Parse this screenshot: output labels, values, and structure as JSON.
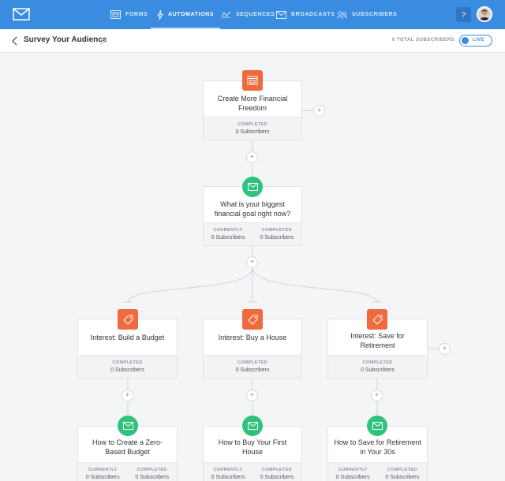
{
  "nav": {
    "items": [
      {
        "label": "FORMS",
        "icon": "forms-icon"
      },
      {
        "label": "AUTOMATIONS",
        "icon": "lightning-icon"
      },
      {
        "label": "SEQUENCES",
        "icon": "sequences-icon"
      },
      {
        "label": "BROADCASTS",
        "icon": "envelope-icon"
      },
      {
        "label": "SUBSCRIBERS",
        "icon": "subscribers-icon"
      }
    ],
    "active": "AUTOMATIONS",
    "help_label": "?"
  },
  "header": {
    "title": "Survey Your Audience",
    "total_subscribers": "0 TOTAL SUBSCRIBERS",
    "status_label": "LIVE"
  },
  "colors": {
    "brand": "#3a8ce0",
    "event": "#ef6a3e",
    "action": "#2fc27d"
  },
  "cards": {
    "trigger": {
      "title": "Create More Financial Freedom",
      "stats": [
        {
          "label": "COMPLETED",
          "value": "0 Subscribers"
        }
      ]
    },
    "question": {
      "title": "What is your biggest financial goal right now?",
      "stats": [
        {
          "label": "CURRENTLY",
          "value": "0 Subscribers"
        },
        {
          "label": "COMPLETED",
          "value": "0 Subscribers"
        }
      ]
    },
    "interest_budget": {
      "title": "Interest: Build a Budget",
      "stats": [
        {
          "label": "COMPLETED",
          "value": "0 Subscribers"
        }
      ]
    },
    "interest_house": {
      "title": "Interest: Buy a House",
      "stats": [
        {
          "label": "COMPLETED",
          "value": "0 Subscribers"
        }
      ]
    },
    "interest_retirement": {
      "title": "Interest: Save for Retirement",
      "stats": [
        {
          "label": "COMPLETED",
          "value": "0 Subscribers"
        }
      ]
    },
    "seq_budget": {
      "title": "How to Create a Zero-Based Budget",
      "stats": [
        {
          "label": "CURRENTLY",
          "value": "0 Subscribers"
        },
        {
          "label": "COMPLETED",
          "value": "0 Subscribers"
        }
      ]
    },
    "seq_house": {
      "title": "How to Buy Your First House",
      "stats": [
        {
          "label": "CURRENTLY",
          "value": "0 Subscribers"
        },
        {
          "label": "COMPLETED",
          "value": "0 Subscribers"
        }
      ]
    },
    "seq_retirement": {
      "title": "How to Save for Retirement in Your 30s",
      "stats": [
        {
          "label": "CURRENTLY",
          "value": "0 Subscribers"
        },
        {
          "label": "COMPLETED",
          "value": "0 Subscribers"
        }
      ]
    }
  },
  "add_step_symbol": "+"
}
